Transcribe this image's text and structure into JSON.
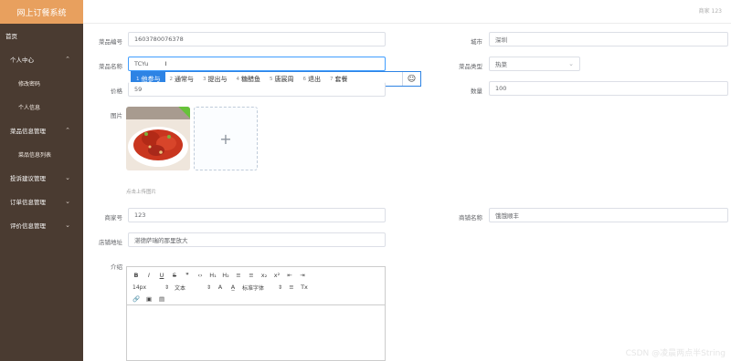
{
  "app": {
    "title": "网上订餐系统",
    "user_info": "商家 123"
  },
  "sidebar": {
    "items": [
      {
        "label": "首页"
      },
      {
        "label": "个人中心"
      },
      {
        "label": "修改密码"
      },
      {
        "label": "个人信息"
      },
      {
        "label": "菜品信息管理"
      },
      {
        "label": "菜品信息列表"
      },
      {
        "label": "投诉建议管理"
      },
      {
        "label": "订单信息管理"
      },
      {
        "label": "评价信息管理"
      }
    ]
  },
  "form": {
    "dish_no": {
      "label": "菜品编号",
      "value": "1603780076378"
    },
    "city": {
      "label": "城市",
      "value": "深圳"
    },
    "dish_name": {
      "label": "菜品名称",
      "value": "TCYu"
    },
    "dish_type": {
      "label": "菜品类型",
      "value": "热菜"
    },
    "price": {
      "label": "价格",
      "value": "59"
    },
    "quantity": {
      "label": "数量",
      "value": "100"
    },
    "image": {
      "label": "图片",
      "upload_hint": "点击上传图片",
      "add_symbol": "+"
    },
    "merchant_no": {
      "label": "商家号",
      "value": "123"
    },
    "shop_name": {
      "label": "商铺名称",
      "value": "饿饿顺丰"
    },
    "address": {
      "label": "店铺地址",
      "value": "湛德萨瑞的那里放大"
    },
    "intro": {
      "label": "介绍"
    }
  },
  "ime": {
    "candidates": [
      {
        "num": "1",
        "text": "他参与"
      },
      {
        "num": "2",
        "text": "通常与"
      },
      {
        "num": "3",
        "text": "提出与"
      },
      {
        "num": "4",
        "text": "糖醋鱼"
      },
      {
        "num": "5",
        "text": "唐宸周"
      },
      {
        "num": "6",
        "text": "退出"
      },
      {
        "num": "7",
        "text": "套餐"
      }
    ],
    "emoji": "☺"
  },
  "editor": {
    "toolbar": {
      "bold": "B",
      "italic": "I",
      "underline": "U",
      "strike": "S",
      "quote": "❞",
      "code": "‹›",
      "h1": "H₁",
      "h2": "H₂",
      "ordered": "≡",
      "bullet": "≡",
      "sub": "x₂",
      "sup": "x²",
      "outdent": "⇤",
      "indent": "⇥",
      "size": "14px",
      "paragraph": "文本",
      "font": "标准字体",
      "color": "A",
      "background": "A̲",
      "align": "≡",
      "clean": "Tx",
      "link": "🔗",
      "image": "▣",
      "video": "▤"
    }
  },
  "watermark": "CSDN @凌晨两点半String",
  "colors": {
    "sidebar_bg": "#4a3b31",
    "brand_bg": "#e8a05e",
    "ime_active": "#2d83e4"
  }
}
